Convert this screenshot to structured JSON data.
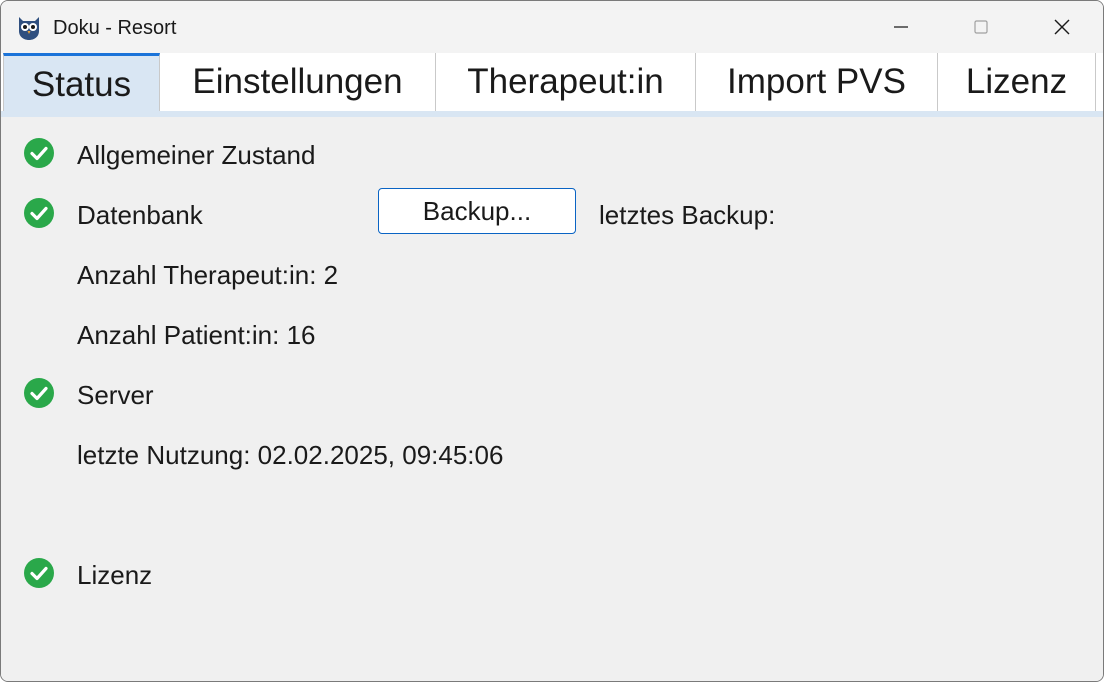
{
  "window": {
    "title": "Doku - Resort",
    "icon": "owl-icon"
  },
  "titlebar_buttons": {
    "minimize": "minimize-icon",
    "maximize": "maximize-icon",
    "close": "close-icon"
  },
  "tabs": [
    {
      "label": "Status",
      "active": true
    },
    {
      "label": "Einstellungen",
      "active": false
    },
    {
      "label": "Therapeut:in",
      "active": false
    },
    {
      "label": "Import PVS",
      "active": false
    },
    {
      "label": "Lizenz",
      "active": false
    }
  ],
  "status": {
    "general": {
      "label": "Allgemeiner Zustand",
      "ok": true
    },
    "database": {
      "label": "Datenbank",
      "ok": true
    },
    "backup_button": "Backup...",
    "last_backup_label": "letztes Backup:",
    "therapist_count": "Anzahl Therapeut:in: 2",
    "patient_count": "Anzahl Patient:in: 16",
    "server": {
      "label": "Server",
      "ok": true
    },
    "last_usage": "letzte Nutzung: 02.02.2025, 09:45:06",
    "license": {
      "label": "Lizenz",
      "ok": true
    }
  },
  "colors": {
    "accent": "#1a73d9",
    "ok_green": "#2aa84a",
    "active_tab_bg": "#d9e6f3"
  }
}
